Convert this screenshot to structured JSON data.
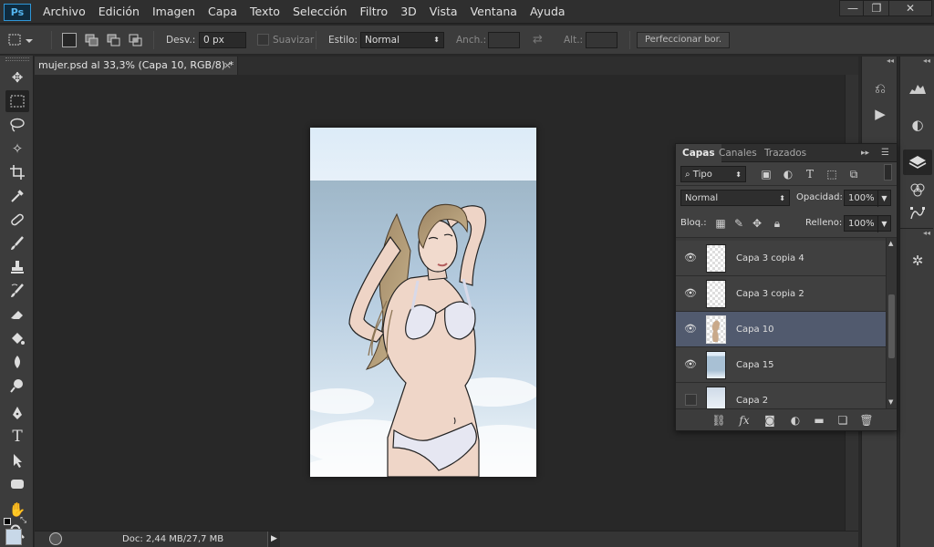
{
  "app": {
    "logo": "Ps",
    "menu": [
      "Archivo",
      "Edición",
      "Imagen",
      "Capa",
      "Texto",
      "Selección",
      "Filtro",
      "3D",
      "Vista",
      "Ventana",
      "Ayuda"
    ],
    "window_buttons": {
      "minimize": "—",
      "restore": "❐",
      "close": "✕"
    }
  },
  "options": {
    "desv_label": "Desv.:",
    "desv_value": "0 px",
    "suavizar_label": "Suavizar",
    "estilo_label": "Estilo:",
    "estilo_value": "Normal",
    "anch_label": "Anch.:",
    "alt_label": "Alt.:",
    "refine_button": "Perfeccionar bor."
  },
  "document": {
    "tab_title": "mujer.psd al 33,3% (Capa 10, RGB/8) *",
    "close_glyph": "×",
    "status": "Doc: 2,44 MB/27,7 MB"
  },
  "layers_panel": {
    "tabs": [
      "Capas",
      "Canales",
      "Trazados"
    ],
    "filter_label": "Tipo",
    "blend_mode": "Normal",
    "opacity_label": "Opacidad:",
    "opacity_value": "100%",
    "lock_label": "Bloq.:",
    "fill_label": "Relleno:",
    "fill_value": "100%",
    "layers": [
      {
        "name": "Capa 3 copia 4",
        "visible": true,
        "selected": false
      },
      {
        "name": "Capa 3 copia 2",
        "visible": true,
        "selected": false
      },
      {
        "name": "Capa 10",
        "visible": true,
        "selected": true
      },
      {
        "name": "Capa 15",
        "visible": true,
        "selected": false
      },
      {
        "name": "Capa 2",
        "visible": false,
        "selected": false
      }
    ],
    "footer_fx": "fx"
  },
  "colors": {
    "accent_selected_layer": "#515a6e",
    "ps_logo": "#2f96d6",
    "panel_bg": "#404040"
  }
}
